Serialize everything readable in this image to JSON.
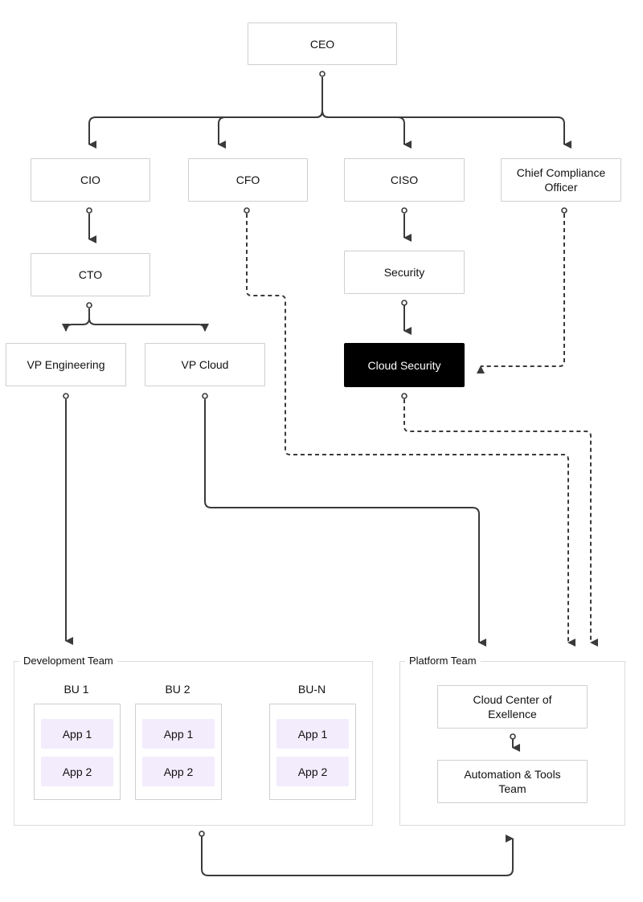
{
  "diagram": {
    "nodes": {
      "ceo": "CEO",
      "cio": "CIO",
      "cfo": "CFO",
      "ciso": "CISO",
      "cco": "Chief Compliance Officer",
      "cto": "CTO",
      "security": "Security",
      "vp_engineering": "VP Engineering",
      "vp_cloud": "VP Cloud",
      "cloud_security": "Cloud Security"
    },
    "development_team": {
      "label": "Development Team",
      "business_units": [
        {
          "name": "BU 1",
          "apps": [
            "App 1",
            "App 2"
          ]
        },
        {
          "name": "BU 2",
          "apps": [
            "App 1",
            "App 2"
          ]
        },
        {
          "name": "BU-N",
          "apps": [
            "App 1",
            "App 2"
          ]
        }
      ]
    },
    "platform_team": {
      "label": "Platform Team",
      "ccoe": "Cloud Center of Exellence",
      "automation": "Automation & Tools Team"
    },
    "edges": [
      {
        "from": "CEO",
        "to": "CIO",
        "style": "solid"
      },
      {
        "from": "CEO",
        "to": "CFO",
        "style": "solid"
      },
      {
        "from": "CEO",
        "to": "CISO",
        "style": "solid"
      },
      {
        "from": "CEO",
        "to": "Chief Compliance Officer",
        "style": "solid"
      },
      {
        "from": "CIO",
        "to": "CTO",
        "style": "solid"
      },
      {
        "from": "CTO",
        "to": "VP Engineering",
        "style": "solid"
      },
      {
        "from": "CTO",
        "to": "VP Cloud",
        "style": "solid"
      },
      {
        "from": "CISO",
        "to": "Security",
        "style": "solid"
      },
      {
        "from": "Security",
        "to": "Cloud Security",
        "style": "solid"
      },
      {
        "from": "Chief Compliance Officer",
        "to": "Cloud Security",
        "style": "dashed"
      },
      {
        "from": "CFO",
        "to": "Platform Team",
        "style": "dashed"
      },
      {
        "from": "Cloud Security",
        "to": "Platform Team",
        "style": "dashed"
      },
      {
        "from": "VP Engineering",
        "to": "Development Team",
        "style": "solid"
      },
      {
        "from": "VP Cloud",
        "to": "Platform Team",
        "style": "solid"
      },
      {
        "from": "Cloud Center of Exellence",
        "to": "Automation & Tools Team",
        "style": "solid"
      },
      {
        "from": "Development Team",
        "to": "Platform Team",
        "style": "solid"
      }
    ],
    "colors": {
      "line": "#3a3a3a",
      "node_border": "#cfcfcf",
      "highlight_node": "#000000",
      "app_fill": "#f3ecfd"
    }
  }
}
